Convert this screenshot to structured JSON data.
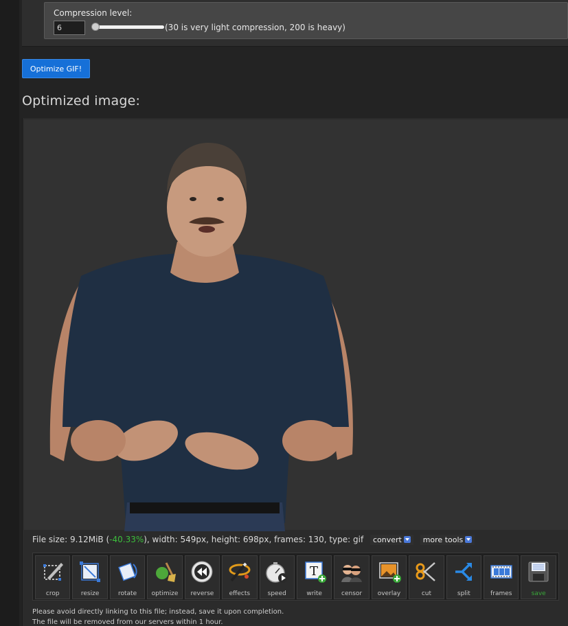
{
  "settings": {
    "compression_label": "Compression level:",
    "compression_value": "6",
    "compression_hint": "(30 is very light compression, 200 is heavy)"
  },
  "optimize_button_label": "Optimize GIF!",
  "section_title": "Optimized image:",
  "file_info": {
    "prefix": "File size: 9.12MiB (",
    "percent": "-40.33%",
    "suffix": "), width: 549px, height: 698px, frames: 130, type: gif",
    "convert_label": "convert",
    "more_tools_label": "more tools"
  },
  "tools": [
    {
      "label": "crop",
      "icon": "crop-icon"
    },
    {
      "label": "resize",
      "icon": "resize-icon"
    },
    {
      "label": "rotate",
      "icon": "rotate-icon"
    },
    {
      "label": "optimize",
      "icon": "broom-icon"
    },
    {
      "label": "reverse",
      "icon": "rewind-icon"
    },
    {
      "label": "effects",
      "icon": "magic-wand-icon"
    },
    {
      "label": "speed",
      "icon": "stopwatch-icon"
    },
    {
      "label": "write",
      "icon": "text-icon"
    },
    {
      "label": "censor",
      "icon": "censor-faces-icon"
    },
    {
      "label": "overlay",
      "icon": "overlay-image-icon"
    },
    {
      "label": "cut",
      "icon": "scissors-icon"
    },
    {
      "label": "split",
      "icon": "split-arrows-icon"
    },
    {
      "label": "frames",
      "icon": "film-strip-icon"
    },
    {
      "label": "save",
      "icon": "floppy-disk-icon"
    }
  ],
  "notice_line1": "Please avoid directly linking to this file; instead, save it upon completion.",
  "notice_line2": "The file will be removed from our servers within 1 hour.",
  "colors": {
    "accent": "#1670d8",
    "positive": "#3cbf3c",
    "save": "#39a839"
  }
}
